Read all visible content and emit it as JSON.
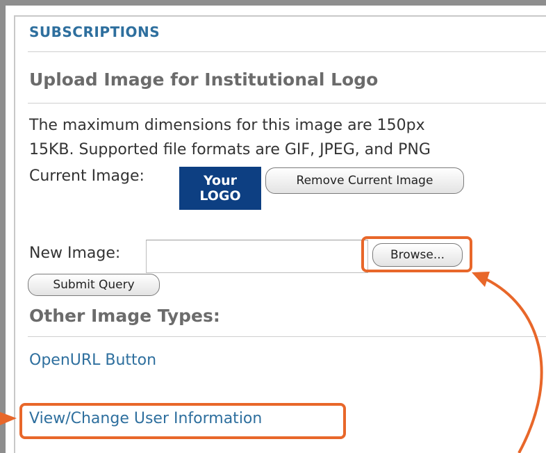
{
  "panel": {
    "section_title": "SUBSCRIPTIONS",
    "upload_heading": "Upload Image for Institutional Logo",
    "description_line1": "The maximum dimensions for this image are 150px",
    "description_line2": "15KB. Supported file formats are GIF, JPEG, and PNG",
    "current_image_label": "Current Image:",
    "logo_line1": "Your",
    "logo_line2": "LOGO",
    "remove_button": "Remove Current Image",
    "new_image_label": "New Image:",
    "new_image_value": "",
    "browse_button": "Browse...",
    "submit_button": "Submit Query",
    "other_types_heading": "Other Image Types:",
    "openurl_link": "OpenURL Button",
    "view_change_link": "View/Change User Information"
  },
  "annotation": {
    "color": "#e8672a"
  }
}
